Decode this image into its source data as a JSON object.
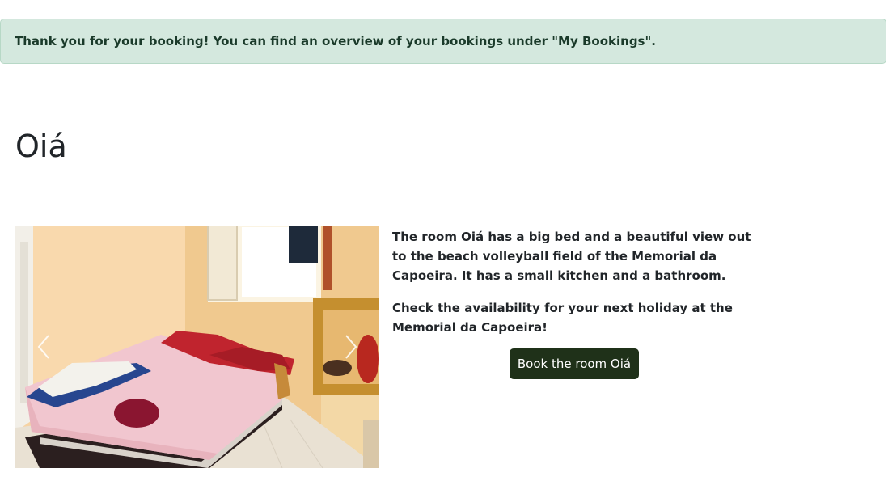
{
  "alert": {
    "message": "Thank you for your booking! You can find an overview of your bookings under \"My Bookings\"."
  },
  "room": {
    "title": "Oiá",
    "description_1": "The room Oiá has a big bed and a beautiful view out to the beach volleyball field of the Memorial da Capoeira. It has a small kitchen and a bathroom.",
    "description_2": "Check the availability for your next holiday at the Memorial da Capoeira!",
    "book_button_label": "Book the room Oiá"
  },
  "carousel": {
    "prev_icon": "chevron-left-icon",
    "next_icon": "chevron-right-icon"
  },
  "colors": {
    "alert_bg": "#d4e8de",
    "alert_text": "#1a3a2a",
    "button_bg": "#1f3119"
  }
}
